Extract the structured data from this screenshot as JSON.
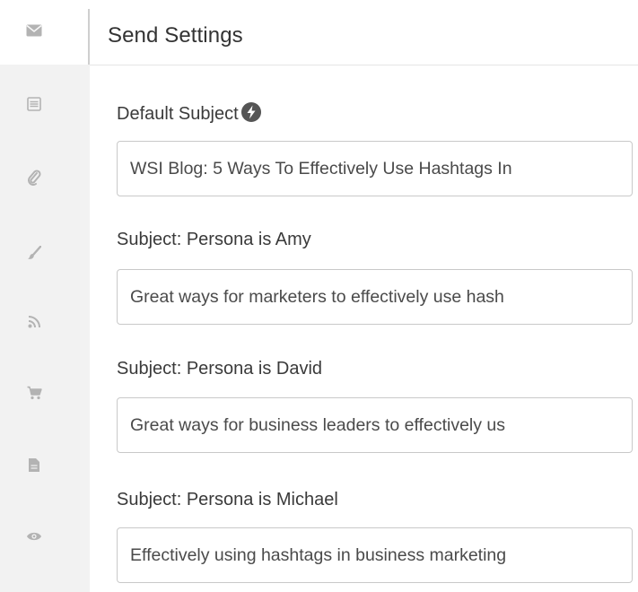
{
  "header": {
    "title": "Send Settings"
  },
  "sidebar": {
    "items": [
      {
        "icon": "envelope-icon",
        "active": true
      },
      {
        "icon": "list-icon"
      },
      {
        "icon": "paperclip-icon"
      },
      {
        "icon": "paintbrush-icon"
      },
      {
        "icon": "rss-icon"
      },
      {
        "icon": "shopping-cart-icon"
      },
      {
        "icon": "document-icon"
      },
      {
        "icon": "eye-icon"
      }
    ]
  },
  "fields": [
    {
      "label": "Default Subject",
      "value": "WSI Blog: 5 Ways To Effectively Use Hashtags In",
      "has_info_icon": true
    },
    {
      "label": "Subject: Persona is Amy",
      "value": "Great ways for marketers to effectively use hash"
    },
    {
      "label": "Subject: Persona is David",
      "value": "Great ways for business leaders to effectively us"
    },
    {
      "label": "Subject: Persona is Michael",
      "value": "Effectively using hashtags in business marketing"
    }
  ],
  "colors": {
    "sidebar_bg": "#f2f2f2",
    "icon": "#b3b3b3",
    "info_badge": "#555555",
    "text": "#3a3a3a",
    "input_border": "#c9c9c9"
  }
}
